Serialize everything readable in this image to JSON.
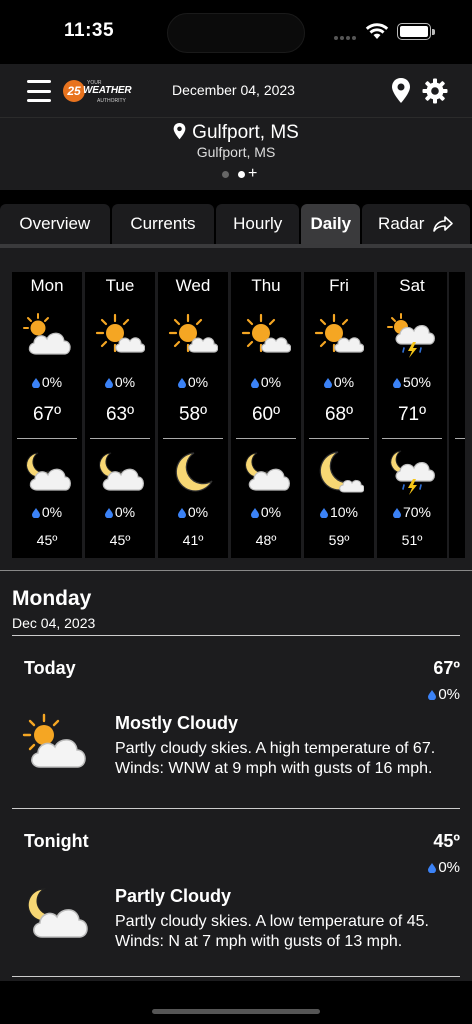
{
  "status_bar": {
    "time": "11:35"
  },
  "header": {
    "logo_number": "25",
    "logo_text": "WEATHER",
    "logo_small": "YOUR",
    "logo_small2": "AUTHORITY",
    "date": "December 04, 2023"
  },
  "location": {
    "main": "Gulfport, MS",
    "sub": "Gulfport, MS",
    "add_label": "+"
  },
  "tabs": [
    {
      "label": "Overview"
    },
    {
      "label": "Currents"
    },
    {
      "label": "Hourly"
    },
    {
      "label": "Daily"
    },
    {
      "label": "Radar"
    }
  ],
  "days": [
    {
      "name": "Mon",
      "day_icon": "partly-cloudy-day-icon",
      "day_precip": "0%",
      "high": "67º",
      "night_icon": "partly-cloudy-night-icon",
      "night_precip": "0%",
      "low": "45º"
    },
    {
      "name": "Tue",
      "day_icon": "partly-sunny-icon",
      "day_precip": "0%",
      "high": "63º",
      "night_icon": "partly-cloudy-night-icon",
      "night_precip": "0%",
      "low": "45º"
    },
    {
      "name": "Wed",
      "day_icon": "partly-sunny-icon",
      "day_precip": "0%",
      "high": "58º",
      "night_icon": "moon-icon",
      "night_precip": "0%",
      "low": "41º"
    },
    {
      "name": "Thu",
      "day_icon": "partly-sunny-icon",
      "day_precip": "0%",
      "high": "60º",
      "night_icon": "partly-cloudy-night-icon",
      "night_precip": "0%",
      "low": "48º"
    },
    {
      "name": "Fri",
      "day_icon": "partly-sunny-icon",
      "day_precip": "0%",
      "high": "68º",
      "night_icon": "mostly-clear-night-icon",
      "night_precip": "10%",
      "low": "59º"
    },
    {
      "name": "Sat",
      "day_icon": "thunderstorm-day-icon",
      "day_precip": "50%",
      "high": "71º",
      "night_icon": "thunderstorm-night-icon",
      "night_precip": "70%",
      "low": "51º"
    }
  ],
  "details": {
    "day": "Monday",
    "date": "Dec 04, 2023",
    "periods": [
      {
        "title": "Today",
        "temp": "67º",
        "precip": "0%",
        "icon": "partly-cloudy-day-icon",
        "condition": "Mostly Cloudy",
        "description": "Partly cloudy skies. A high temperature of 67. Winds: WNW at 9 mph with gusts of 16 mph."
      },
      {
        "title": "Tonight",
        "temp": "45º",
        "precip": "0%",
        "icon": "partly-cloudy-night-icon",
        "condition": "Partly Cloudy",
        "description": "Partly cloudy skies. A low temperature of 45. Winds: N at 7 mph with gusts of 13 mph."
      }
    ]
  },
  "colors": {
    "background": "#000000",
    "panel": "#1c1c1e",
    "active_tab": "#3a3a3c",
    "sun": "#f5a623",
    "drop": "#3b82f6",
    "moon": "#f7d774",
    "bolt": "#f5c518",
    "rain": "#2f6fd6",
    "logo": "#e8731e"
  }
}
